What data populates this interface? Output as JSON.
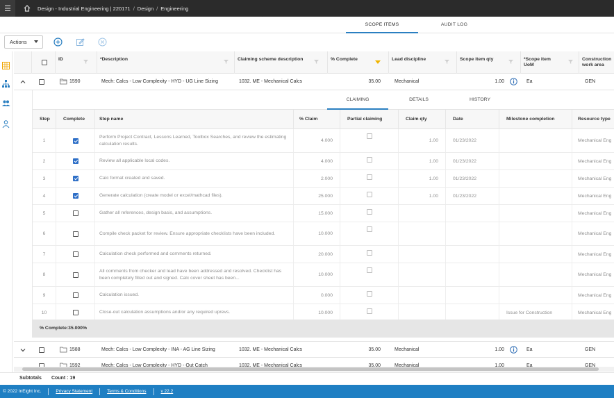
{
  "topbar": {
    "breadcrumb": [
      "Design - Industrial Engineering | 220171",
      "Design",
      "Engineering"
    ],
    "separator": "/"
  },
  "tabs": [
    "SCOPE ITEMS",
    "AUDIT LOG"
  ],
  "active_tab": "SCOPE ITEMS",
  "toolbar": {
    "actions_label": "Actions"
  },
  "grid": {
    "columns": [
      "ID",
      "*Description",
      "Claiming scheme description",
      "% Complete",
      "Lead discipline",
      "Scope item qty",
      "*Scope item UoM",
      "Construction work area"
    ],
    "rows": [
      {
        "id": "1590",
        "description": "Mech: Calcs - Low Complexity - HYD - UG Line Sizing",
        "scheme": "1032. ME - Mechanical Calcs",
        "complete": "35.00",
        "discipline": "Mechanical",
        "qty": "1.00",
        "uom": "Ea",
        "area": "GEN"
      },
      {
        "id": "1588",
        "description": "Mech: Calcs - Low Complexity - INA - AG Line Sizing",
        "scheme": "1032. ME - Mechanical Calcs",
        "complete": "35.00",
        "discipline": "Mechanical",
        "qty": "1.00",
        "uom": "Ea",
        "area": "GEN"
      }
    ]
  },
  "detail": {
    "tabs": [
      "CLAIMING",
      "DETAILS",
      "HISTORY"
    ],
    "active_tab": "CLAIMING",
    "columns": [
      "Step",
      "Complete",
      "Step name",
      "% Claim",
      "Partial claiming",
      "Claim qty",
      "Date",
      "Milestone completion",
      "Resource type"
    ],
    "steps": [
      {
        "step": "1",
        "checked": true,
        "name": "Perform Project Contract, Lessons Learned, Toolbox Searches, and review the estimating calculation results.",
        "claim": "4.000",
        "qty": "1.00",
        "date": "01/23/2022",
        "milestone": "",
        "resource": "Mechanical Eng"
      },
      {
        "step": "2",
        "checked": true,
        "name": "Review all applicable local codes.",
        "claim": "4.000",
        "qty": "1.00",
        "date": "01/23/2022",
        "milestone": "",
        "resource": "Mechanical Eng"
      },
      {
        "step": "3",
        "checked": true,
        "name": "Calc format created and saved.",
        "claim": "2.000",
        "qty": "1.00",
        "date": "01/23/2022",
        "milestone": "",
        "resource": "Mechanical Eng"
      },
      {
        "step": "4",
        "checked": true,
        "name": "Generate calculation (create model or excel/mathcad files).",
        "claim": "25.000",
        "qty": "1.00",
        "date": "01/23/2022",
        "milestone": "",
        "resource": "Mechanical Eng"
      },
      {
        "step": "5",
        "checked": false,
        "name": "Gather all references, design basis, and assumptions.",
        "claim": "15.000",
        "qty": "",
        "date": "",
        "milestone": "",
        "resource": "Mechanical Eng"
      },
      {
        "step": "6",
        "checked": false,
        "name": "Compile check packet for review. Ensure appropriate checklists have been included.",
        "claim": "10.000",
        "qty": "",
        "date": "",
        "milestone": "",
        "resource": "Mechanical Eng"
      },
      {
        "step": "7",
        "checked": false,
        "name": "Calculation check performed and comments returned.",
        "claim": "20.000",
        "qty": "",
        "date": "",
        "milestone": "",
        "resource": "Mechanical Eng"
      },
      {
        "step": "8",
        "checked": false,
        "name": "All comments from checker and lead have been addressed and resolved. Checklist has been completely filled out and signed. Calc cover sheet has been...",
        "claim": "10.000",
        "qty": "",
        "date": "",
        "milestone": "",
        "resource": "Mechanical Eng"
      },
      {
        "step": "9",
        "checked": false,
        "name": "Calculation issued.",
        "claim": "0.000",
        "qty": "",
        "date": "",
        "milestone": "",
        "resource": "Mechanical Eng"
      },
      {
        "step": "10",
        "checked": false,
        "name": "Close-out calculation assumptions and/or any required uprevs.",
        "claim": "10.000",
        "qty": "",
        "date": "",
        "milestone": "Issue for Construction",
        "resource": "Mechanical Eng"
      }
    ],
    "summary": "% Complete:35.000%"
  },
  "partial_row": {
    "id": "1592",
    "description": "Mech: Calcs - Low Complexity - HYD - Out Catch",
    "scheme": "1032. ME - Mechanical Calcs",
    "complete": "35.00",
    "discipline": "Mechanical",
    "qty": "1.00",
    "uom": "Ea",
    "area": "GEN"
  },
  "subtotals": {
    "label": "Subtotals",
    "count": "Count : 19"
  },
  "footer": {
    "copyright": "© 2022 InEight Inc.",
    "privacy": "Privacy Statement",
    "terms": "Terms & Conditions",
    "version": "v 22.2"
  }
}
